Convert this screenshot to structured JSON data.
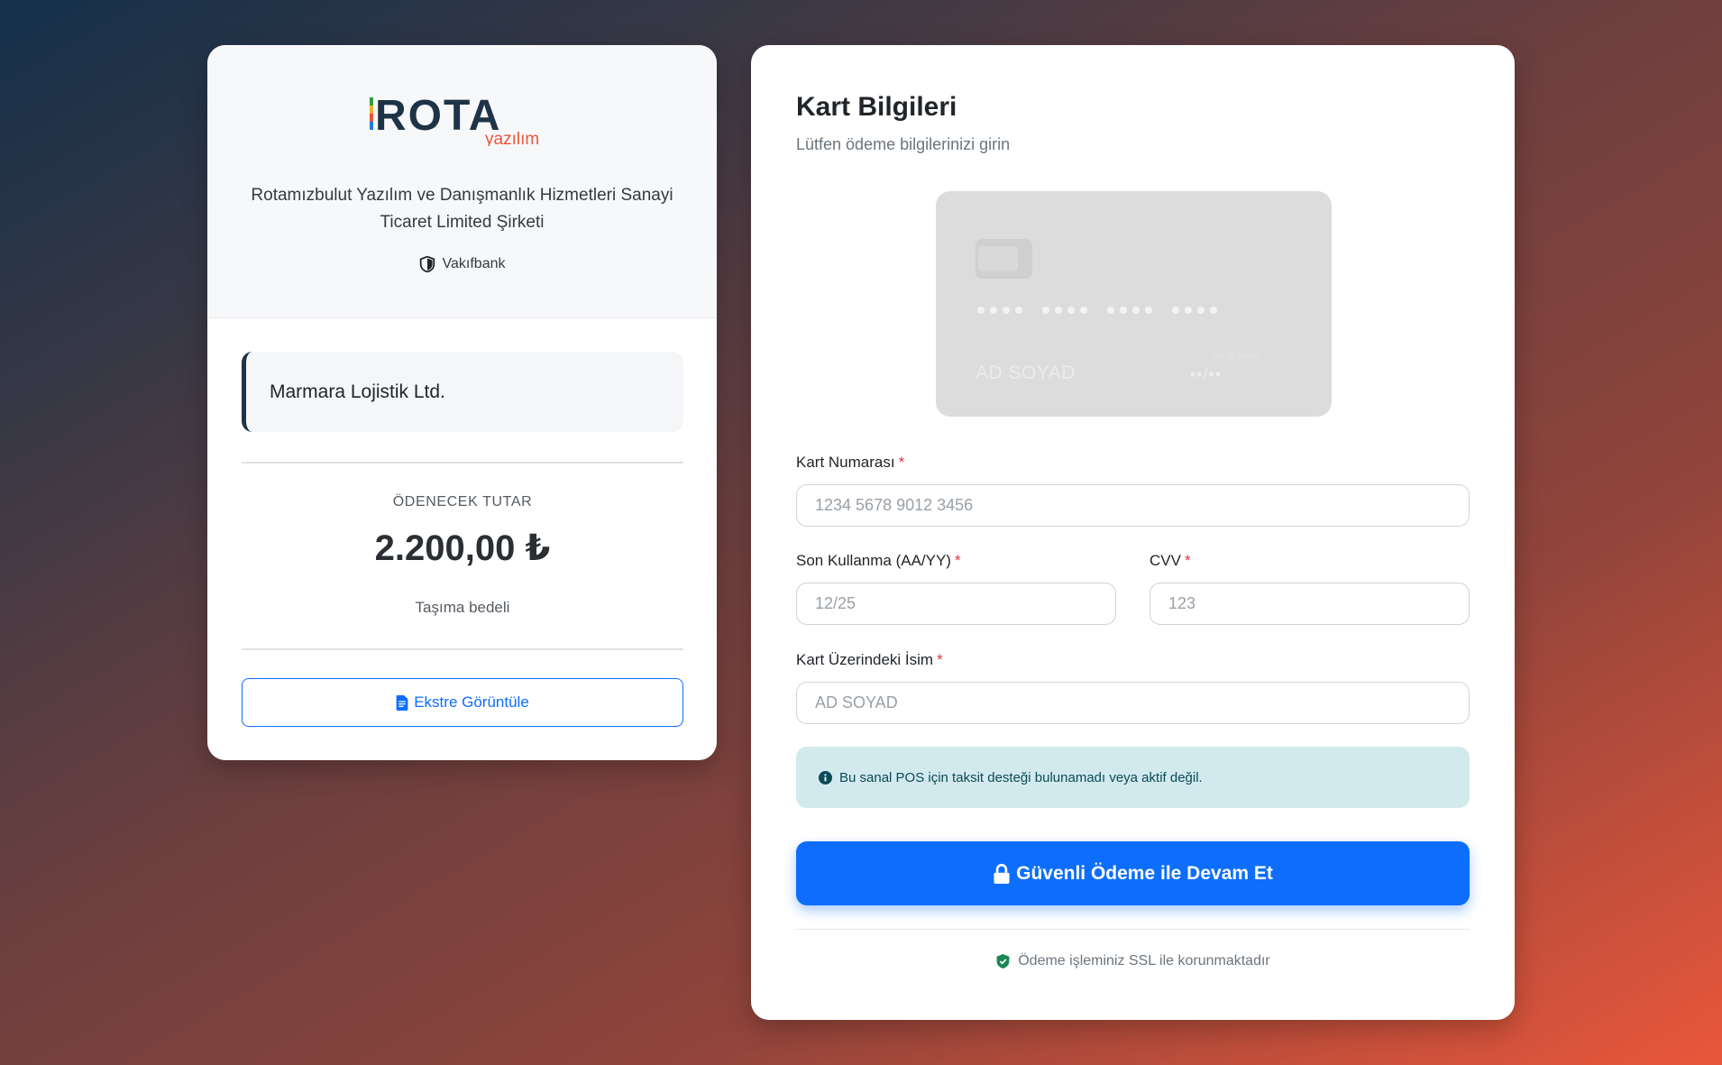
{
  "colors": {
    "primary": "#0d6efd",
    "required": "#dc3545",
    "info_bg": "#d2eaee",
    "ssl_icon": "#198754",
    "logo_dark": "#1f3347",
    "logo_red": "#e9573b"
  },
  "merchant": {
    "logo_text": "ROTA",
    "logo_subtext": "yazılım",
    "company_name": "Rotamızbulut Yazılım ve Danışmanlık Hizmetleri Sanayi Ticaret Limited Şirketi",
    "bank_icon": "shield-half-icon",
    "bank_name": "Vakıfbank"
  },
  "summary": {
    "customer_name": "Marmara Lojistik Ltd.",
    "amount_label": "ÖDENECEK TUTAR",
    "amount": "2.200,00 ₺",
    "description": "Taşıma bedeli",
    "statement_icon": "file-text-icon",
    "statement_button": "Ekstre Görüntüle"
  },
  "form": {
    "title": "Kart Bilgileri",
    "subtitle": "Lütfen ödeme bilgilerinizi girin",
    "card_preview": {
      "number_mask": "•••• •••• •••• ••••",
      "holder": "AD SOYAD",
      "expiry_label": "VALID THRU",
      "expiry": "••/••"
    },
    "card_number": {
      "label": "Kart Numarası",
      "required_mark": "*",
      "placeholder": "1234 5678 9012 3456",
      "value": ""
    },
    "expiry": {
      "label": "Son Kullanma (AA/YY)",
      "required_mark": "*",
      "placeholder": "12/25",
      "value": ""
    },
    "cvv": {
      "label": "CVV",
      "required_mark": "*",
      "placeholder": "123",
      "value": ""
    },
    "holder_name": {
      "label": "Kart Üzerindeki İsim",
      "required_mark": "*",
      "placeholder": "AD SOYAD",
      "value": ""
    },
    "info_icon": "info-circle-icon",
    "info_message": "Bu sanal POS için taksit desteği bulunamadı veya aktif değil.",
    "submit_icon": "lock-icon",
    "submit_label": "Güvenli Ödeme ile Devam Et",
    "ssl_icon": "shield-check-icon",
    "ssl_note": "Ödeme işleminiz SSL ile korunmaktadır"
  }
}
